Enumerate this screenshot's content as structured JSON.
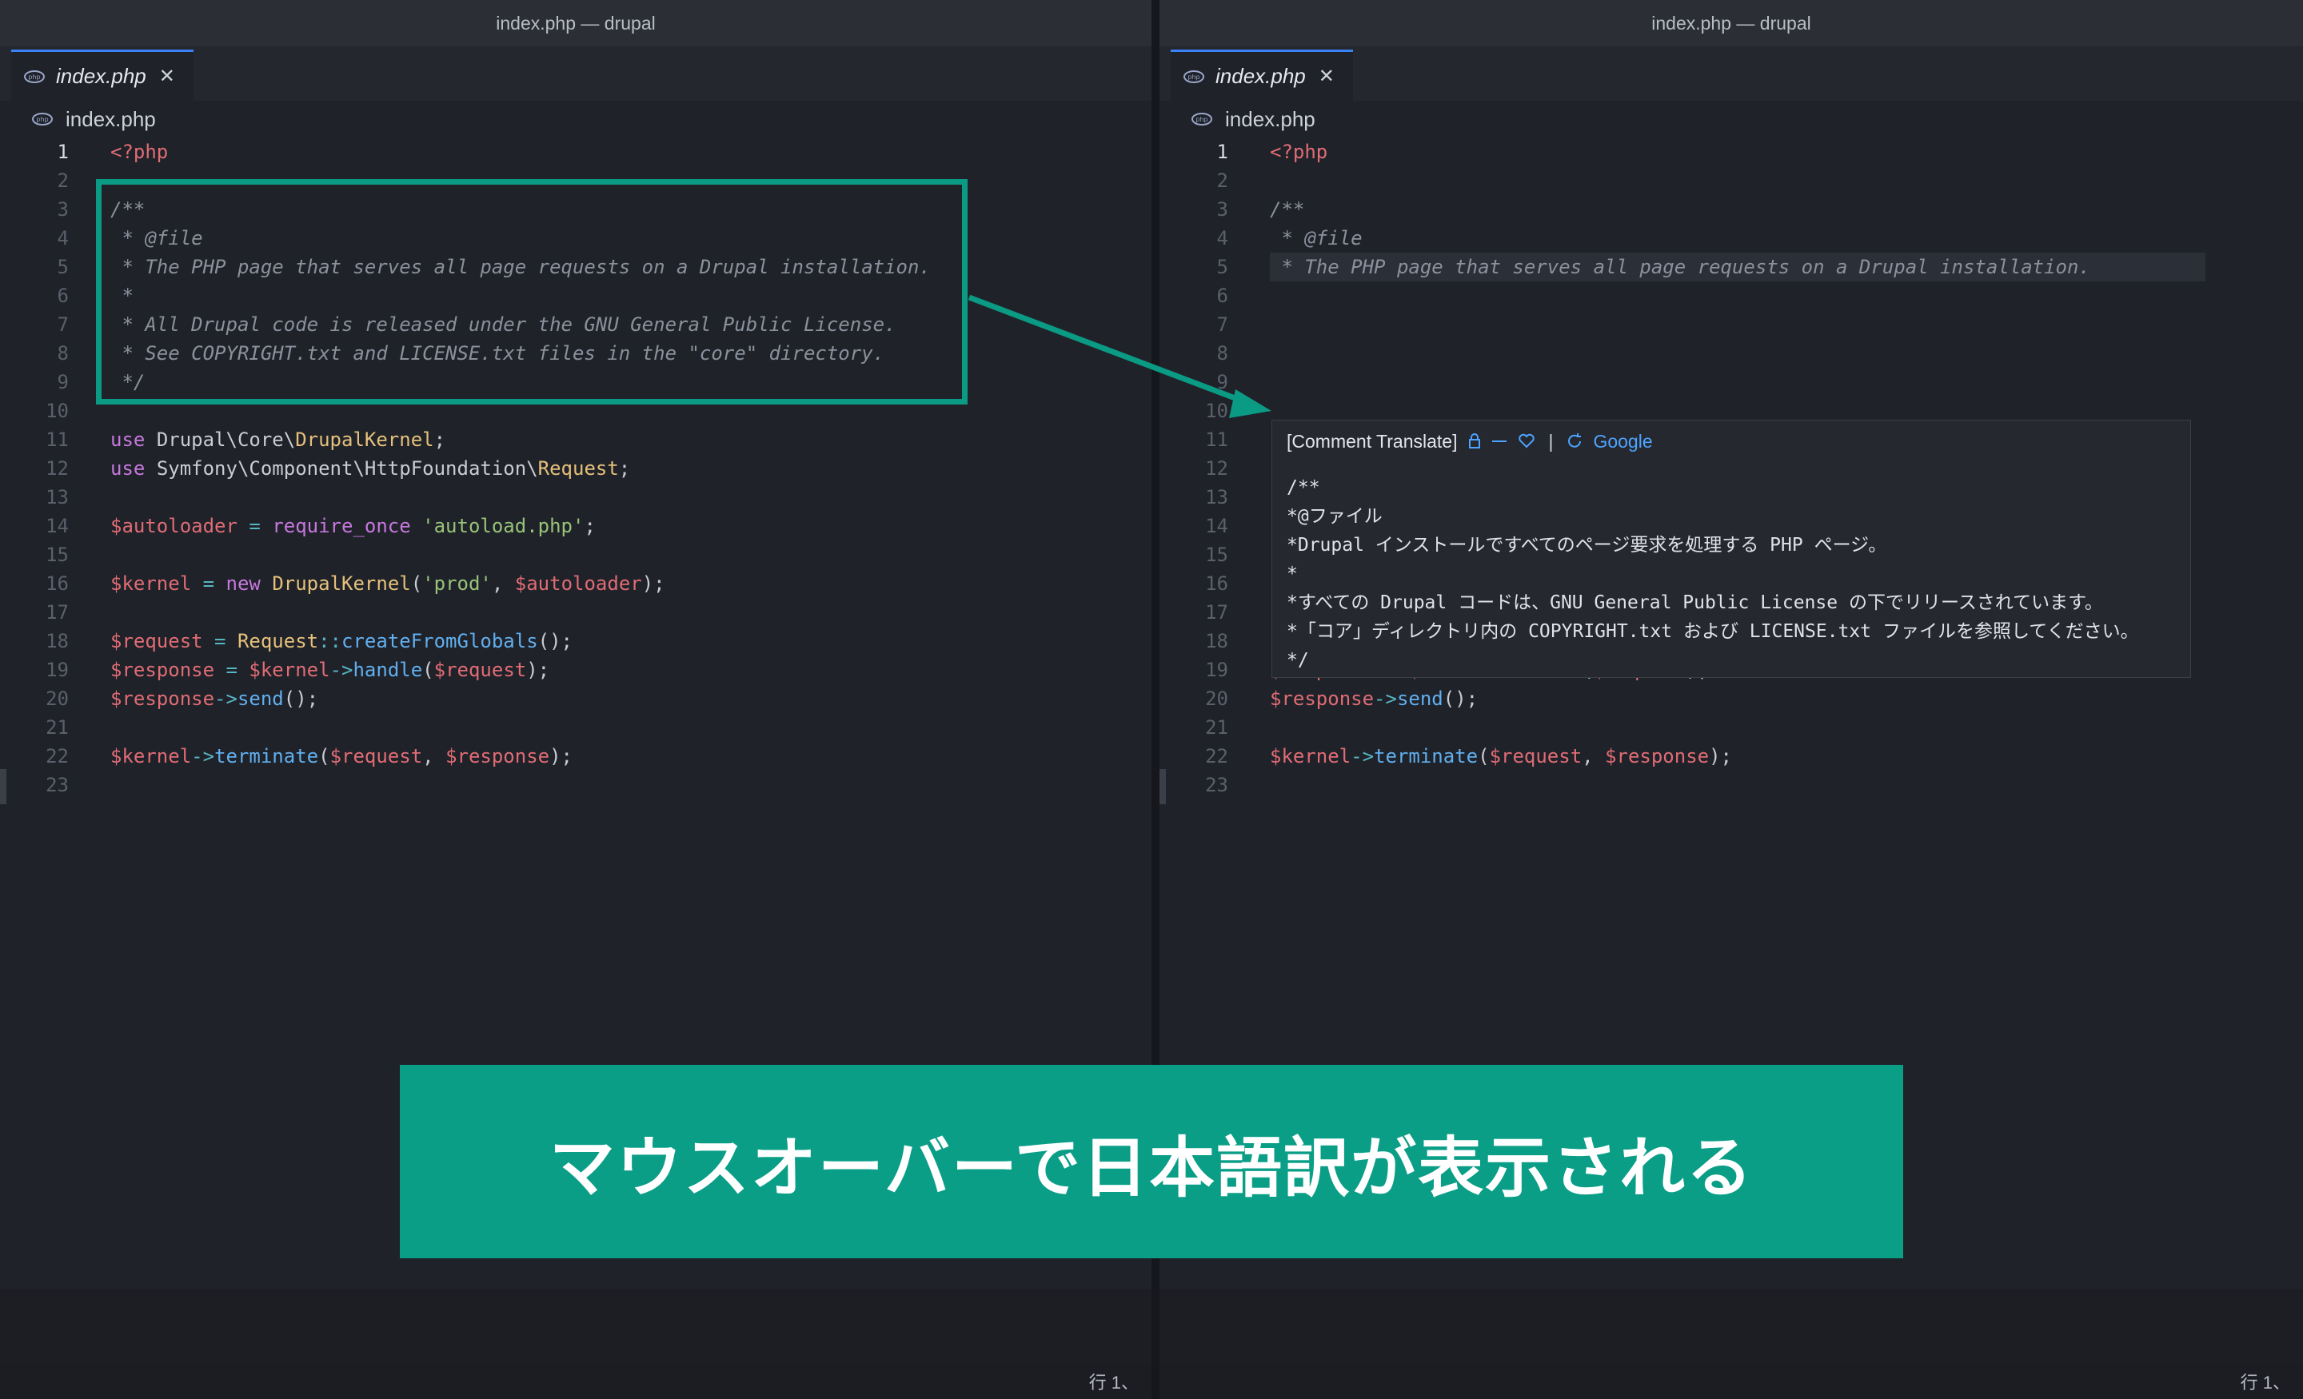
{
  "window": {
    "title": "index.php — drupal"
  },
  "tab": {
    "label": "index.php",
    "icon": "elephant-icon",
    "close": "✕"
  },
  "breadcrumb": {
    "label": "index.php",
    "icon": "elephant-icon"
  },
  "status": {
    "cursor": "行 1、"
  },
  "code_lines": {
    "l1": "<?php",
    "l3": "/**",
    "l4": " * @file",
    "l5": " * The PHP page that serves all page requests on a Drupal installation.",
    "l6": " *",
    "l7": " * All Drupal code is released under the GNU General Public License.",
    "l8": " * See COPYRIGHT.txt and LICENSE.txt files in the \"core\" directory.",
    "l9": " */",
    "l11": {
      "use": "use",
      "ns": "Drupal\\Core\\",
      "cls": "DrupalKernel",
      "end": ";"
    },
    "l12": {
      "use": "use",
      "ns": "Symfony\\Component\\HttpFoundation\\",
      "cls": "Request",
      "end": ";"
    },
    "l14": {
      "var": "$autoloader",
      "eq": " = ",
      "kw": "require_once",
      "str": "'autoload.php'",
      "end": ";"
    },
    "l16": {
      "var": "$kernel",
      "eq": " = ",
      "kw": "new",
      "cls": "DrupalKernel",
      "p1": "(",
      "str": "'prod'",
      "comma": ", ",
      "var2": "$autoloader",
      "end": ");"
    },
    "l18": {
      "var": "$request",
      "eq": " = ",
      "cls": "Request",
      "op": "::",
      "fn": "createFromGlobals",
      "end": "();"
    },
    "l19": {
      "var": "$response",
      "eq": " = ",
      "var2": "$kernel",
      "op": "->",
      "fn": "handle",
      "p1": "(",
      "var3": "$request",
      "end": ");"
    },
    "l20": {
      "var": "$response",
      "op": "->",
      "fn": "send",
      "end": "();"
    },
    "l22": {
      "var": "$kernel",
      "op": "->",
      "fn": "terminate",
      "p1": "(",
      "var2": "$request",
      "comma": ", ",
      "var3": "$response",
      "end": ");"
    }
  },
  "popup": {
    "title": "[Comment Translate]",
    "divider": "|",
    "provider": "Google",
    "lines": [
      "/**",
      "*@ファイル",
      "*Drupal インストールですべてのページ要求を処理する PHP ページ。",
      "*",
      "*すべての Drupal コードは、GNU General Public License の下でリリースされています。",
      "*「コア」ディレクトリ内の COPYRIGHT.txt および LICENSE.txt ファイルを参照してください。",
      "*/"
    ]
  },
  "banner": {
    "text": "マウスオーバーで日本語訳が表示される"
  },
  "colors": {
    "accent": "#0a9e87",
    "link": "#4da3ff"
  }
}
